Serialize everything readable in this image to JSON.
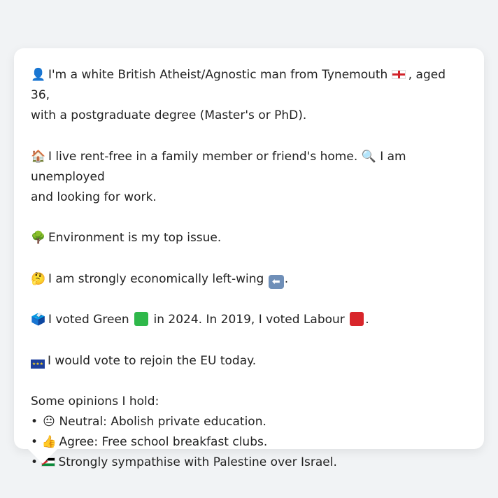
{
  "colors": {
    "background": "#f1f3f5",
    "card": "#ffffff",
    "text": "#222222",
    "green_square": "#2fb84a",
    "red_square": "#d8262b",
    "arrow_box": "#6f8fb8"
  },
  "profile": {
    "intro": {
      "icon": "👤",
      "text_a": "I'm a white British Atheist/Agnostic man from Tynemouth",
      "flag_name": "england-flag-icon",
      "text_b": ", aged 36,",
      "text_c": "with a postgraduate degree (Master's or PhD)."
    },
    "living": {
      "icon_home": "🏠",
      "text_a": "I live rent-free in a family member or friend's home.",
      "icon_search": "🔍",
      "text_b": "I am unemployed",
      "text_c": "and looking for work."
    },
    "issue": {
      "icon": "🌳",
      "text": "Environment is my top issue."
    },
    "economics": {
      "icon": "🤔",
      "text": "I am strongly economically left-wing",
      "arrow_glyph": "⬅",
      "end": "."
    },
    "votes": {
      "icon": "🗳️",
      "text_a": "I voted Green",
      "text_b": "in 2024. In 2019, I voted Labour",
      "end": "."
    },
    "eu": {
      "flag_stars": "★★★",
      "text": "I would vote to rejoin the EU today."
    },
    "opinions": {
      "heading": "Some opinions I hold:",
      "bullet": "•",
      "items": [
        {
          "icon": "😐",
          "text": "Neutral: Abolish private education."
        },
        {
          "icon": "👍",
          "text": "Agree: Free school breakfast clubs."
        },
        {
          "icon": "",
          "text": "Strongly sympathise with Palestine over Israel."
        }
      ]
    }
  }
}
